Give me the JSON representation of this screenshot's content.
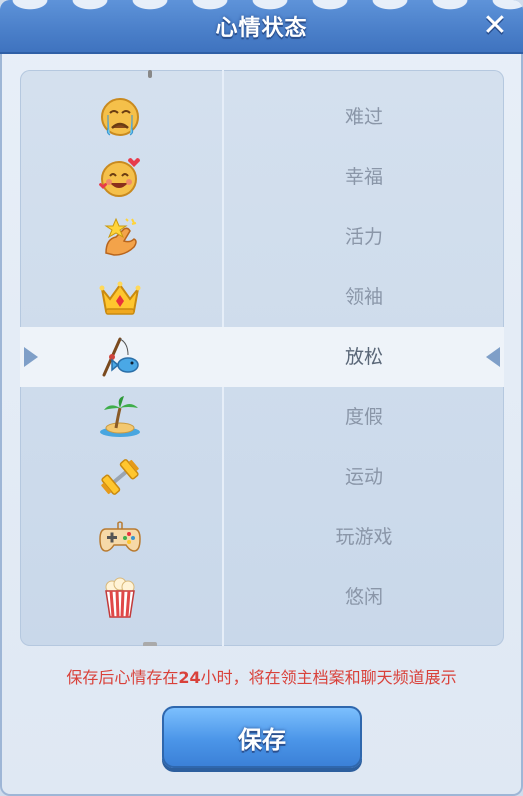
{
  "dialog": {
    "title": "心情状态",
    "close_icon": "close-x-icon"
  },
  "mood_list": {
    "selected_index": 4,
    "items": [
      {
        "label": "难过",
        "icon": "crying-face-icon"
      },
      {
        "label": "幸福",
        "icon": "smiling-hearts-face-icon"
      },
      {
        "label": "活力",
        "icon": "flexing-arm-star-icon"
      },
      {
        "label": "领袖",
        "icon": "crown-icon"
      },
      {
        "label": "放松",
        "icon": "fishing-rod-fish-icon"
      },
      {
        "label": "度假",
        "icon": "palm-tree-island-icon"
      },
      {
        "label": "运动",
        "icon": "dumbbell-icon"
      },
      {
        "label": "玩游戏",
        "icon": "gamepad-icon"
      },
      {
        "label": "悠闲",
        "icon": "popcorn-icon"
      }
    ]
  },
  "notice": {
    "prefix": "保存后心情存在",
    "hours": "24",
    "suffix": "小时，将在领主档案和聊天频道展示"
  },
  "save_button": {
    "label": "保存"
  },
  "colors": {
    "title_bar": "#4a7fc9",
    "notice_text": "#d9413a",
    "button": "#4b95e8"
  }
}
